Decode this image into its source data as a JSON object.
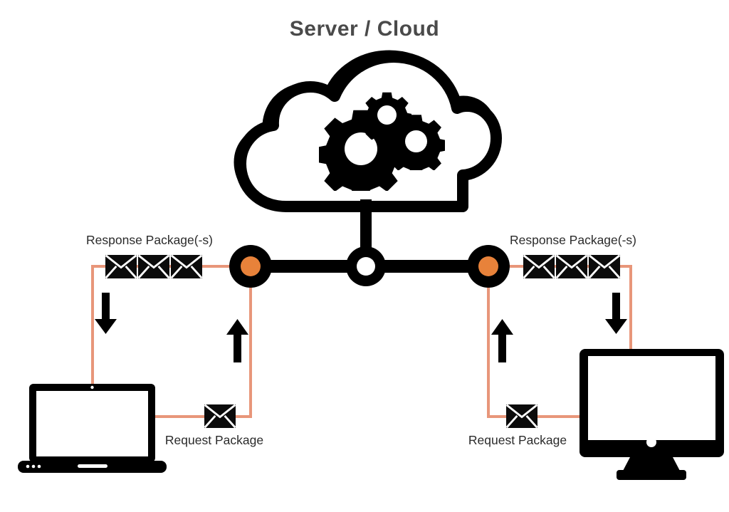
{
  "diagram": {
    "title": "Server / Cloud",
    "background_color": "#ffffff",
    "title_color": "#4a4a4a",
    "label_color": "#2b2b2b",
    "line_color": "#e8967a",
    "node_color": "#000000",
    "node_accent_color": "#e8823a",
    "icon_color": "#000000",
    "screen_color": "#ffffff"
  },
  "center": {
    "cloud_name": "cloud",
    "gears": [
      {
        "name": "gear-large"
      },
      {
        "name": "gear-small-top"
      },
      {
        "name": "gear-medium-right"
      }
    ],
    "bus_nodes": [
      {
        "name": "node-left",
        "fill": "#e8823a"
      },
      {
        "name": "node-center",
        "fill": "#ffffff"
      },
      {
        "name": "node-right",
        "fill": "#e8823a"
      }
    ]
  },
  "left_branch": {
    "response_label": "Response Package(-s)",
    "request_label": "Request Package",
    "response_envelope_count": 3,
    "request_envelope_count": 1,
    "device": "laptop",
    "arrows": [
      {
        "name": "arrow-down-response",
        "direction": "down"
      },
      {
        "name": "arrow-up-request",
        "direction": "up"
      }
    ]
  },
  "right_branch": {
    "response_label": "Response Package(-s)",
    "request_label": "Request Package",
    "response_envelope_count": 3,
    "request_envelope_count": 1,
    "device": "desktop-monitor",
    "arrows": [
      {
        "name": "arrow-up-request",
        "direction": "up"
      },
      {
        "name": "arrow-down-response",
        "direction": "down"
      }
    ]
  }
}
